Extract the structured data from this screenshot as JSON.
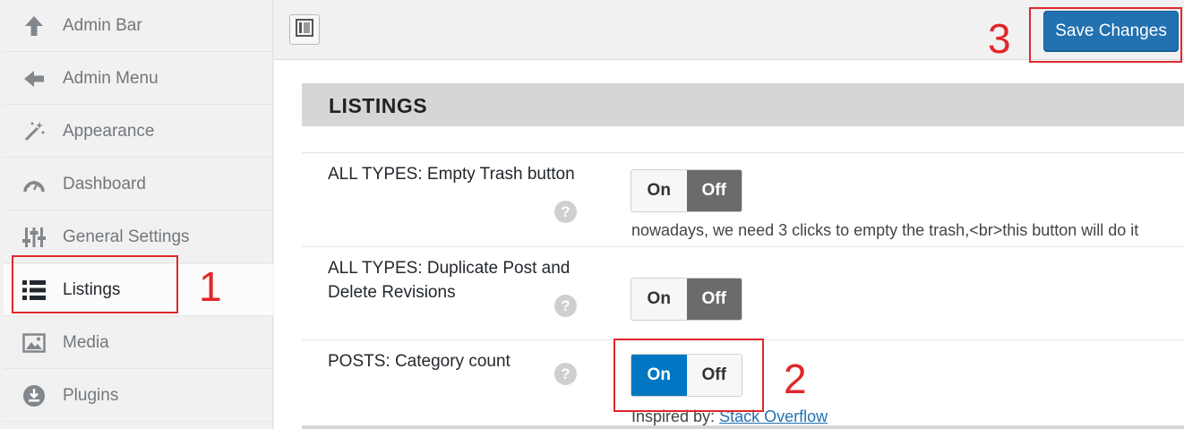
{
  "sidebar": {
    "items": [
      {
        "label": "Admin Bar",
        "icon": "arrow-up-icon"
      },
      {
        "label": "Admin Menu",
        "icon": "arrow-left-icon"
      },
      {
        "label": "Appearance",
        "icon": "magic-wand-icon"
      },
      {
        "label": "Dashboard",
        "icon": "dashboard-gauge-icon"
      },
      {
        "label": "General Settings",
        "icon": "sliders-icon"
      },
      {
        "label": "Listings",
        "icon": "list-icon"
      },
      {
        "label": "Media",
        "icon": "image-icon"
      },
      {
        "label": "Plugins",
        "icon": "plugin-download-icon"
      }
    ]
  },
  "toolbar": {
    "save_label": "Save Changes"
  },
  "section": {
    "title": "LISTINGS"
  },
  "options": [
    {
      "title": "ALL TYPES: Empty Trash button",
      "on_label": "On",
      "off_label": "Off",
      "value": "Off",
      "description": "nowadays, we need 3 clicks to empty the trash,<br>this button will do it"
    },
    {
      "title": "ALL TYPES: Duplicate Post and Delete Revisions",
      "on_label": "On",
      "off_label": "Off",
      "value": "Off"
    },
    {
      "title": "POSTS: Category count",
      "on_label": "On",
      "off_label": "Off",
      "value": "On",
      "description_prefix": "Inspired by: ",
      "description_link": "Stack Overflow"
    }
  ],
  "help_glyph": "?",
  "annotations": {
    "one": "1",
    "two": "2",
    "three": "3"
  },
  "colors": {
    "accent": "#2271b1",
    "toggle_on": "#0077c2",
    "toggle_off": "#6b6b6b",
    "annotation": "#e0272b"
  }
}
